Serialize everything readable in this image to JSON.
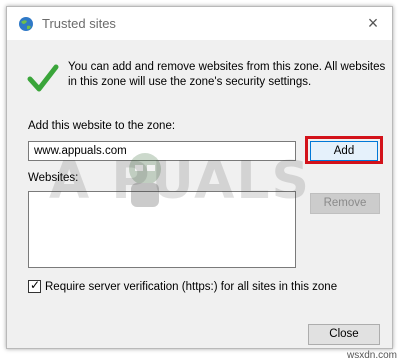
{
  "window": {
    "title": "Trusted sites",
    "close_icon": "×"
  },
  "info": {
    "text": "You can add and remove websites from this zone. All websites in this zone will use the zone's security settings."
  },
  "add_section": {
    "label": "Add this website to the zone:",
    "input_value": "www.appuals.com",
    "add_label": "Add"
  },
  "websites": {
    "label": "Websites:",
    "items": [],
    "remove_label": "Remove"
  },
  "verification": {
    "checked": true,
    "label": "Require server verification (https:) for all sites in this zone"
  },
  "footer": {
    "close_label": "Close"
  },
  "watermark": {
    "logo_text": "A PUALS",
    "site": "wsxdn.com"
  },
  "colors": {
    "highlight": "#d3121a",
    "check_green": "#3aa53a",
    "add_focus": "#0078d7"
  }
}
